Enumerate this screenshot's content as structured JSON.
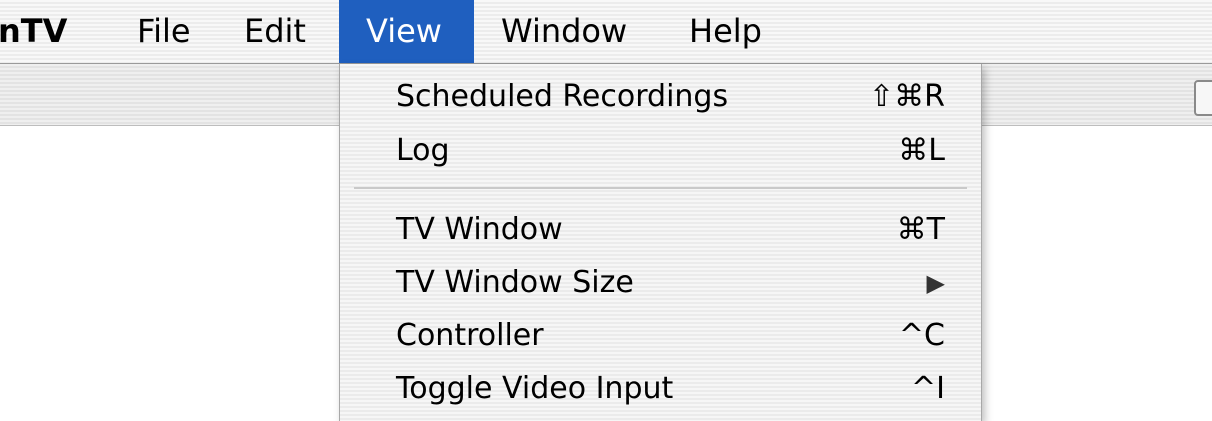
{
  "menubar": {
    "app_name": "nTV",
    "items": [
      "File",
      "Edit",
      "View",
      "Window",
      "Help"
    ]
  },
  "view_menu": {
    "items": [
      {
        "label": "Scheduled Recordings",
        "shortcut": "⇧⌘R"
      },
      {
        "label": "Log",
        "shortcut": "⌘L"
      },
      {
        "label": "TV Window",
        "shortcut": "⌘T"
      },
      {
        "label": "TV Window Size",
        "submenu_indicator": "▶"
      },
      {
        "label": "Controller",
        "shortcut": "^C"
      },
      {
        "label": "Toggle Video Input",
        "shortcut": "^I"
      }
    ]
  },
  "colors": {
    "menu_highlight": "#1f5fbf"
  }
}
